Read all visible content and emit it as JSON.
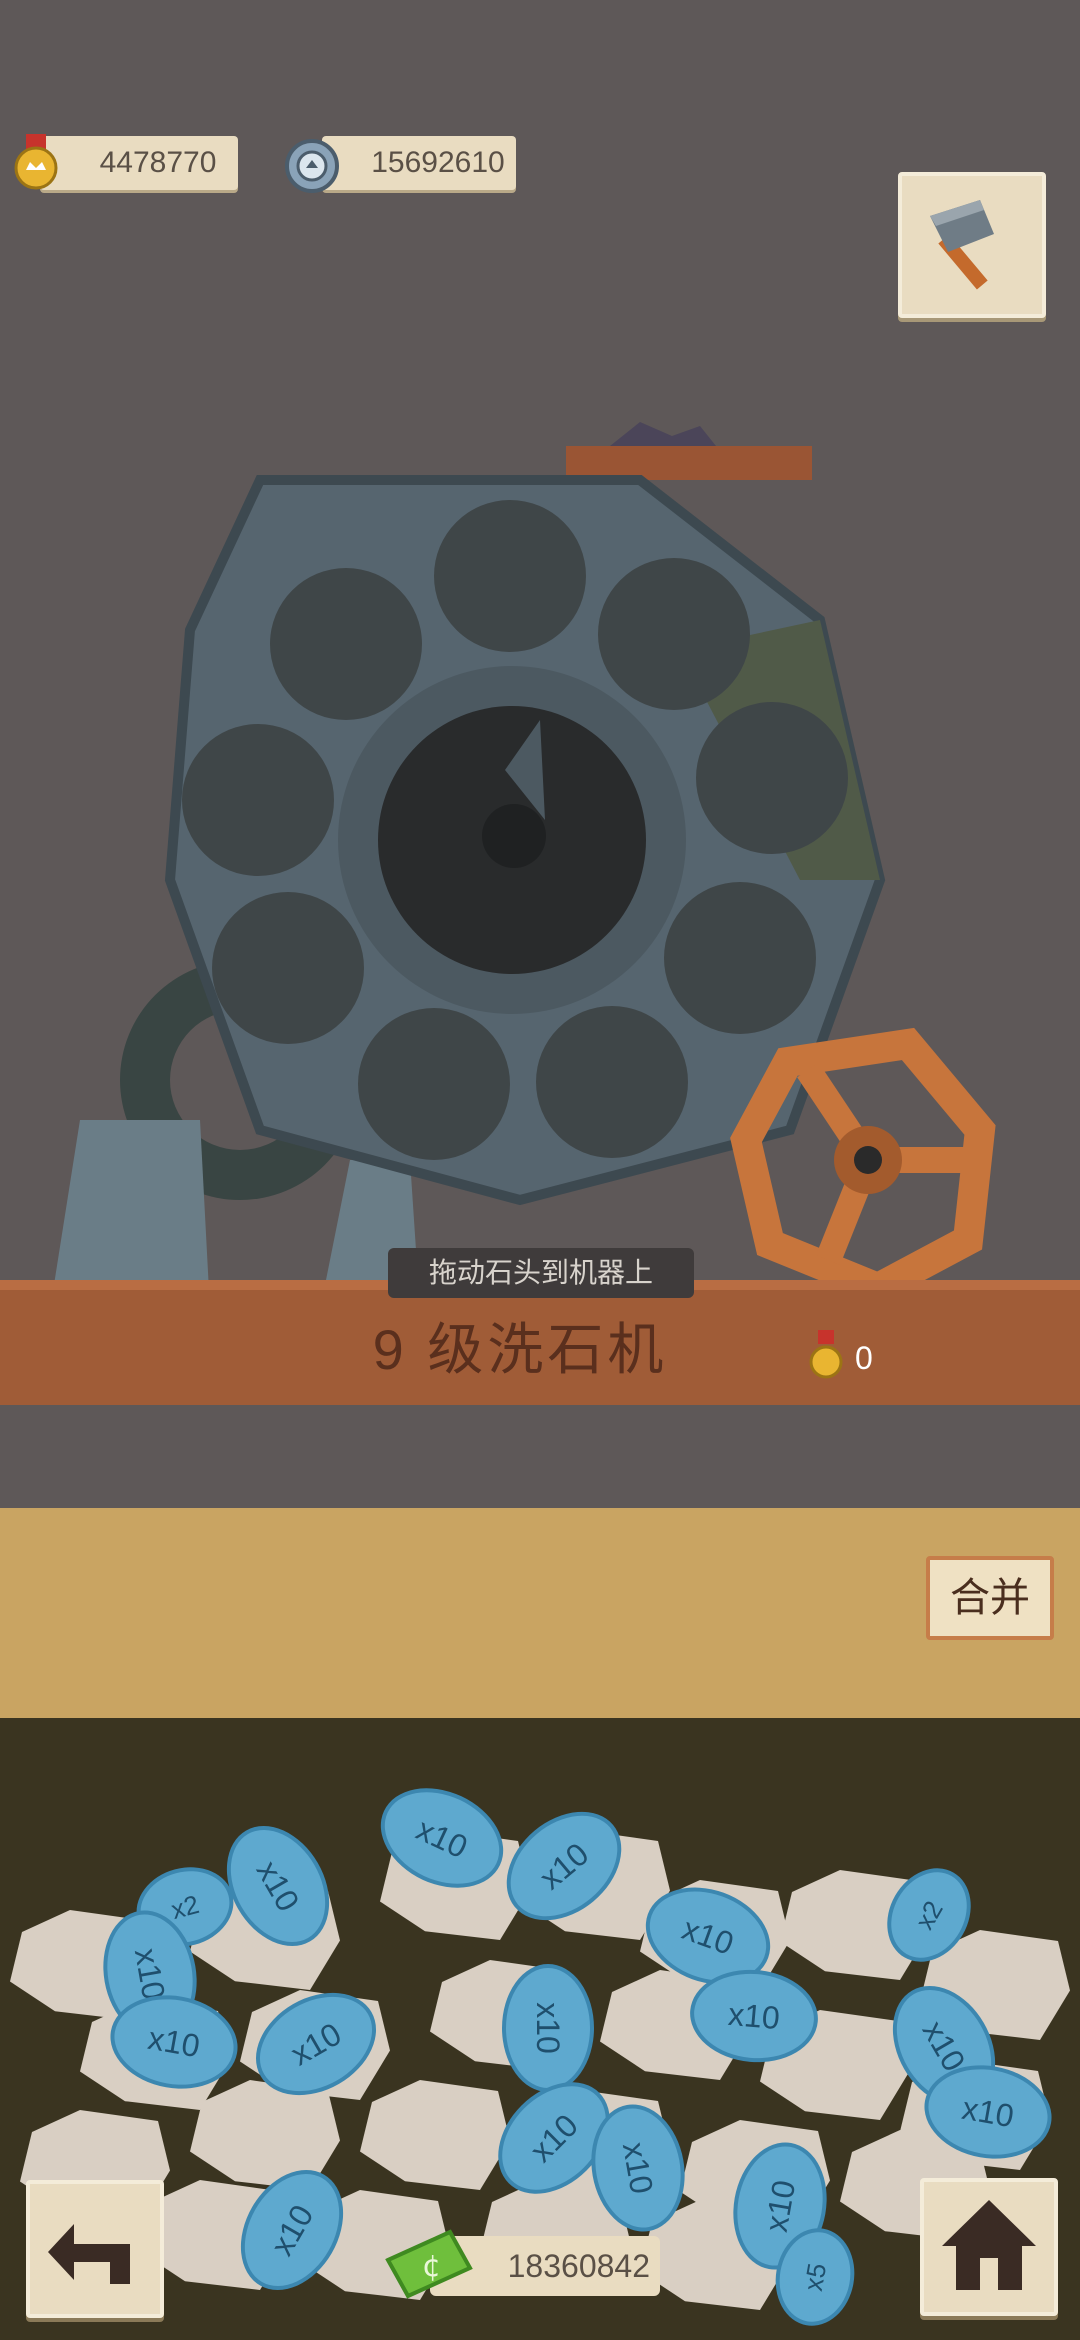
{
  "currency": {
    "medals": "4478770",
    "gems": "15692610"
  },
  "machine": {
    "hint": "拖动石头到机器上",
    "title": "9 级洗石机",
    "cost": "0"
  },
  "merge_button": "合并",
  "cash": "18360842",
  "tags": [
    "x2",
    "x10",
    "x10",
    "x10",
    "x10",
    "x2",
    "x10",
    "x10",
    "x10",
    "x10",
    "x10",
    "x10",
    "x10",
    "x10",
    "x10",
    "x10",
    "x10",
    "x5"
  ],
  "icons": {
    "medal": "medal-icon",
    "gem": "gem-icon",
    "hammer": "hammer-icon",
    "back": "back-arrow-icon",
    "home": "home-icon",
    "cash": "cash-icon"
  },
  "colors": {
    "background": "#5e5858",
    "plank": "#a05c37",
    "tag": "#5ea9cf",
    "paper": "#e9dcc1"
  }
}
